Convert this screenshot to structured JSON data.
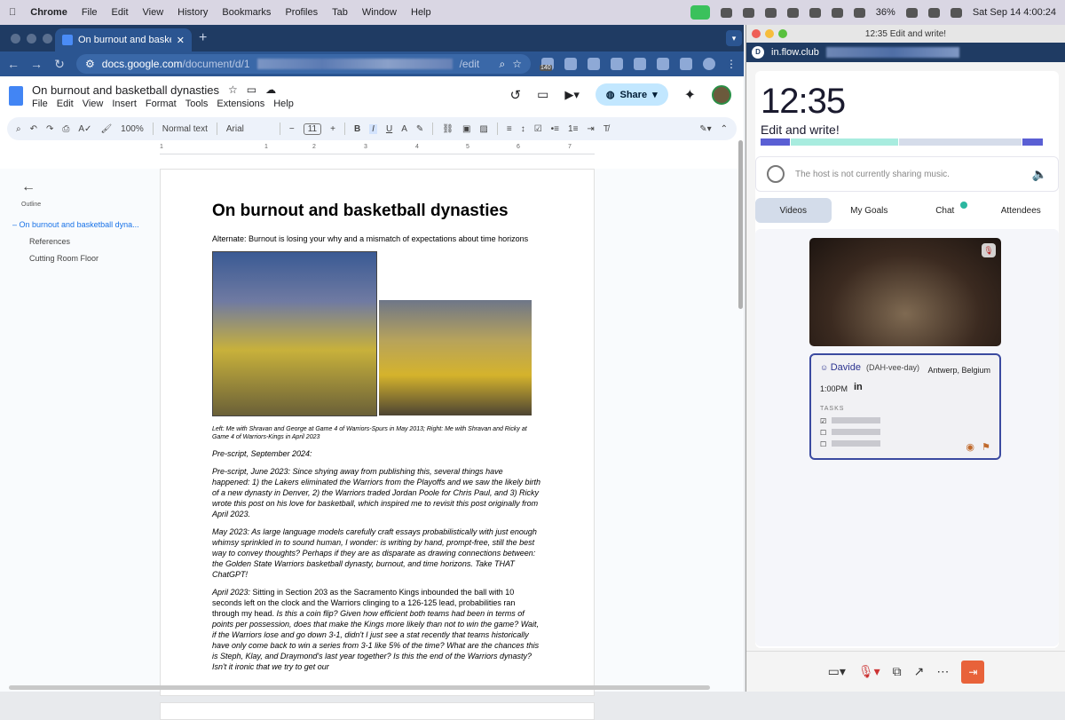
{
  "menubar": {
    "app": "Chrome",
    "items": [
      "File",
      "Edit",
      "View",
      "History",
      "Bookmarks",
      "Profiles",
      "Tab",
      "Window",
      "Help"
    ],
    "battery": "36%",
    "datetime": "Sat Sep 14  4:00:24"
  },
  "chrome": {
    "tab_title": "On burnout and basketball dy",
    "url_host": "docs.google.com",
    "url_path": "/document/d/1",
    "url_suffix": "/edit",
    "ext_badge": "140"
  },
  "docs": {
    "title": "On burnout and basketball dynasties",
    "menu": [
      "File",
      "Edit",
      "View",
      "Insert",
      "Format",
      "Tools",
      "Extensions",
      "Help"
    ],
    "share_label": "Share",
    "toolbar": {
      "zoom": "100%",
      "style": "Normal text",
      "font": "Arial",
      "font_size": "11"
    },
    "ruler": [
      "1",
      "1",
      "2",
      "3",
      "4",
      "5",
      "6",
      "7"
    ],
    "outline": {
      "label": "Outline",
      "items": [
        "On burnout and basketball dyna...",
        "References",
        "Cutting Room Floor"
      ]
    },
    "page": {
      "heading": "On burnout and basketball dynasties",
      "subtitle": "Alternate: Burnout is losing your why and a mismatch of expectations about time horizons",
      "caption": "Left: Me with Shravan and George at Game 4 of Warriors-Spurs in May 2013; Right: Me with Shravan and Ricky at Game 4 of Warriors-Kings in April 2023",
      "prescript": "Pre-script, September 2024:",
      "p1": "Pre-script, June 2023: Since shying away from publishing this, several things have happened: 1) the Lakers eliminated the Warriors from the Playoffs and we saw the likely birth of a new dynasty in Denver, 2) the Warriors traded Jordan Poole for Chris Paul, and 3) Ricky wrote this post on his love for basketball, which inspired me to revisit this post originally from April 2023.",
      "p2": "May 2023: As large language models carefully craft essays probabilistically with just enough whimsy sprinkled in to sound human, I wonder: is writing by hand, prompt-free, still the best way to convey thoughts? Perhaps if they are as disparate as drawing connections between: the Golden State Warriors basketball dynasty, burnout, and time horizons. Take THAT ChatGPT!",
      "p3_lead": "April 2023:",
      "p3_plain": " Sitting in Section 203 as the Sacramento Kings inbounded the ball with 10 seconds left on the clock and the Warriors clinging to a 126-125 lead, probabilities ran through my head. ",
      "p3_italic": "Is this a coin flip? Given how efficient both teams had been in terms of points per possession, does that make the Kings more likely than not to win the game? Wait, if the Warriors lose and go down 3-1, didn't I just see a stat recently that teams historically have only come back to win a series from 3-1 like 5% of the time? What are the chances this is Steph, Klay, and Draymond's last year together? Is this the end of the Warriors dynasty? Isn't it ironic that we try to get our"
    }
  },
  "flow": {
    "window_title": "12:35 Edit and write!",
    "url": "in.flow.club",
    "timer": "12:35",
    "session": "Edit and write!",
    "progress": [
      {
        "frac": 0.1,
        "color": "#5a5fd4"
      },
      {
        "frac": 0.37,
        "color": "#a8ecdf"
      },
      {
        "frac": 0.42,
        "color": "#d5dcea"
      },
      {
        "frac": 0.07,
        "color": "#5a5fd4"
      }
    ],
    "music_text": "The host is not currently sharing music.",
    "tabs": [
      "Videos",
      "My Goals",
      "Chat",
      "Attendees"
    ],
    "card": {
      "name": "Davide",
      "pronunciation": "(DAH-vee-day)",
      "location": "Antwerp, Belgium",
      "time": "1:00PM",
      "linkedin": "in",
      "tasks_label": "TASKS",
      "task_checks": [
        "☑",
        "☐",
        "☐"
      ]
    }
  }
}
